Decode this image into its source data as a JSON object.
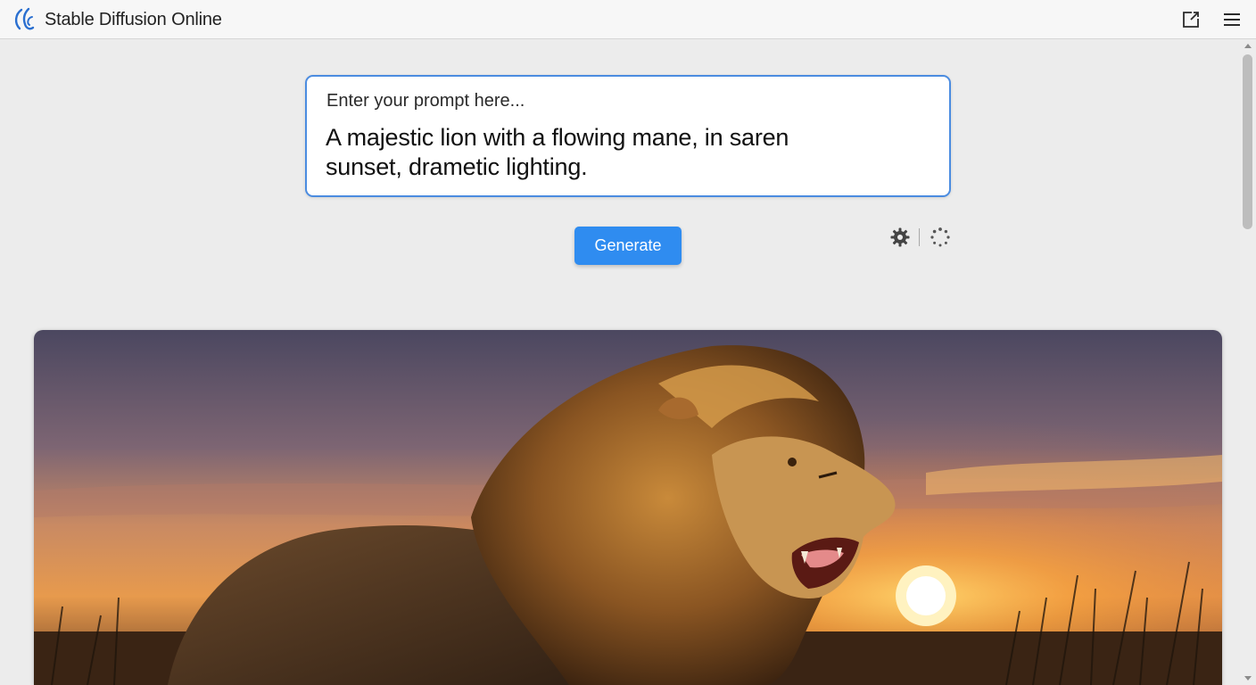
{
  "header": {
    "title_part1": "Stable Diffusion",
    "title_part2": "Online",
    "logo_icon": "stable-diffusion-logo-icon",
    "share_icon": "share-external-icon",
    "menu_icon": "hamburger-menu-icon"
  },
  "prompt": {
    "placeholder": "Enter your prompt here...",
    "value": "A majestic lion with a flowing mane, in saren sunset, drametic lighting."
  },
  "actions": {
    "generate_label": "Generate",
    "settings_icon": "gear-icon",
    "loading_icon": "loading-spinner-icon"
  },
  "result": {
    "image_subject": "lion-at-sunset"
  },
  "colors": {
    "accent": "#2f8cf0",
    "prompt_border": "#4b8ce0",
    "page_background": "#ececec"
  }
}
